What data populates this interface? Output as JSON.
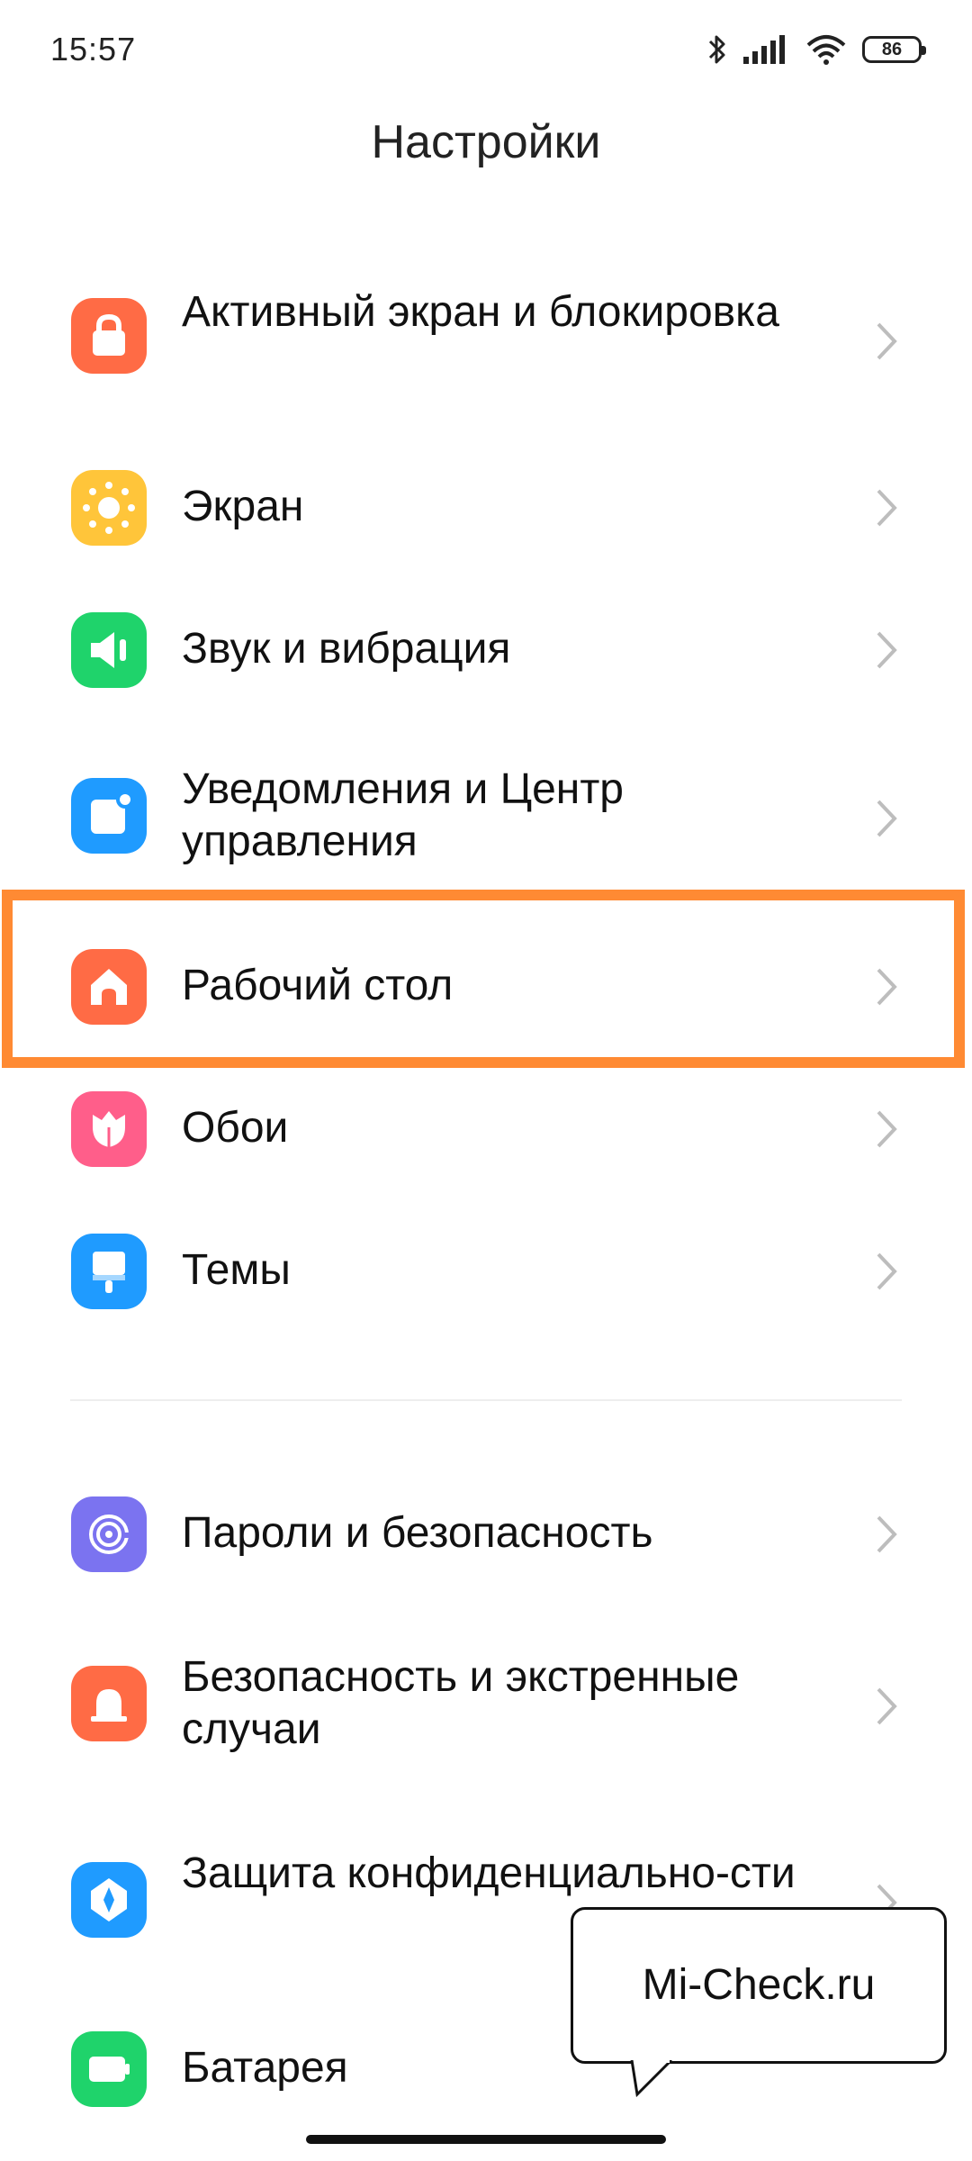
{
  "status_bar": {
    "time": "15:57",
    "battery_level": "86"
  },
  "header": {
    "title": "Настройки"
  },
  "group1": [
    {
      "label": "Активный экран и блокировка",
      "icon": "lock-icon",
      "color": "#ff6b45"
    },
    {
      "label": "Экран",
      "icon": "sun-icon",
      "color": "#ffc53a"
    },
    {
      "label": "Звук и вибрация",
      "icon": "speaker-icon",
      "color": "#1fd36b"
    },
    {
      "label": "Уведомления и Центр управления",
      "icon": "notification-icon",
      "color": "#1f9bff"
    },
    {
      "label": "Рабочий стол",
      "icon": "home-icon",
      "color": "#ff6b45",
      "highlighted": true
    },
    {
      "label": "Обои",
      "icon": "flower-icon",
      "color": "#ff5e8a"
    },
    {
      "label": "Темы",
      "icon": "brush-icon",
      "color": "#1f9bff"
    }
  ],
  "group2": [
    {
      "label": "Пароли и безопасность",
      "icon": "fingerprint-icon",
      "color": "#7b73f0"
    },
    {
      "label": "Безопасность и экстренные случаи",
      "icon": "emergency-icon",
      "color": "#ff6b45"
    },
    {
      "label": "Защита конфиденциально-сти",
      "icon": "privacy-shield-icon",
      "color": "#1f9bff"
    },
    {
      "label": "Батарея",
      "icon": "battery-icon",
      "color": "#1fd36b"
    }
  ],
  "watermark": {
    "text": "Mi-Check.ru"
  },
  "colors": {
    "highlight_border": "#ff8a33",
    "chevron": "#bdbdbd"
  }
}
